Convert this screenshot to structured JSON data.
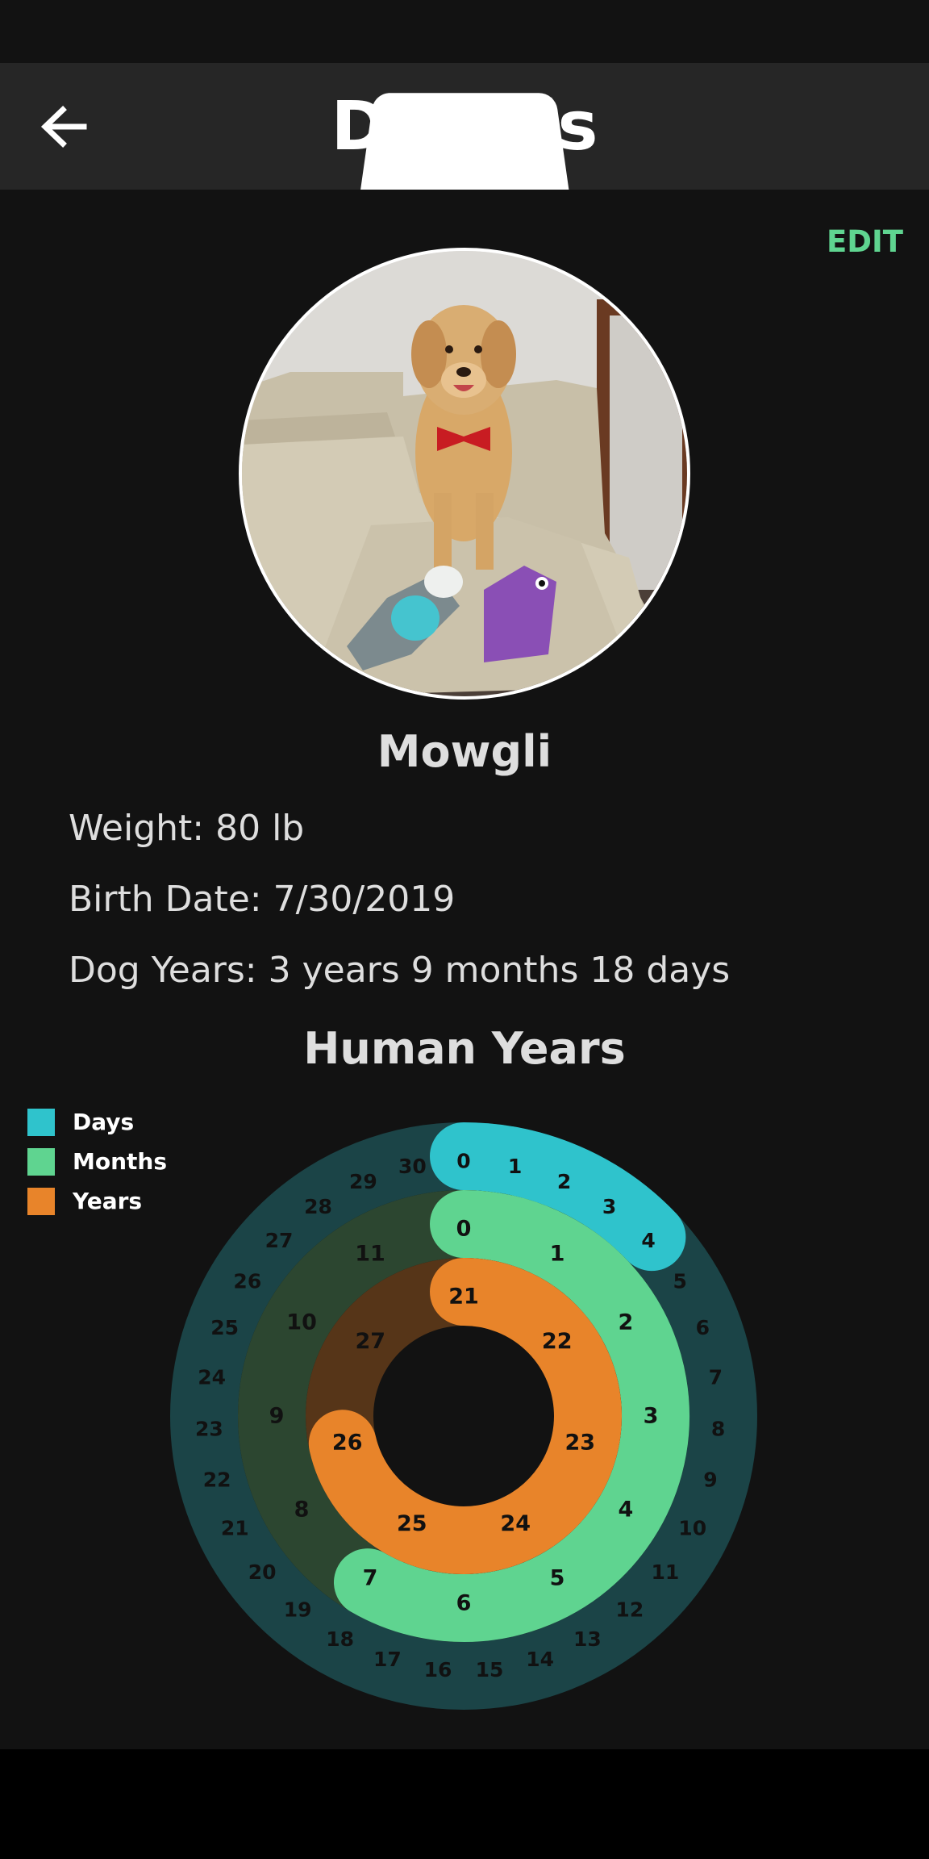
{
  "header": {
    "title": "Details",
    "back_icon": "arrow-left-icon",
    "settings_icon": "gear-icon"
  },
  "edit_label": "EDIT",
  "profile": {
    "photo_desc": "golden-retriever-photo",
    "name": "Mowgli",
    "weight": "Weight: 80 lb",
    "birth_date": "Birth Date: 7/30/2019",
    "dog_years": "Dog Years: 3 years 9 months 18 days"
  },
  "chart_title": "Human Years",
  "legend": [
    {
      "label": "Days",
      "color": "#2fc3cc"
    },
    {
      "label": "Months",
      "color": "#5fd490"
    },
    {
      "label": "Years",
      "color": "#e8842a"
    }
  ],
  "colors": {
    "accent": "#5fd490",
    "days": "#2fc3cc",
    "months": "#5fd490",
    "years": "#e8842a",
    "days_track": "#1b4447",
    "months_track": "#2c4630",
    "years_track": "#563518",
    "background": "#121212"
  },
  "chart_data": {
    "type": "radial-progress",
    "title": "Human Years",
    "series": [
      {
        "name": "Days",
        "ticks": [
          0,
          1,
          2,
          3,
          4,
          5,
          6,
          7,
          8,
          9,
          10,
          11,
          12,
          13,
          14,
          15,
          16,
          17,
          18,
          19,
          20,
          21,
          22,
          23,
          24,
          25,
          26,
          27,
          28,
          29,
          30
        ],
        "value": 4
      },
      {
        "name": "Months",
        "ticks": [
          0,
          1,
          2,
          3,
          4,
          5,
          6,
          7,
          8,
          9,
          10,
          11
        ],
        "value": 7
      },
      {
        "name": "Years",
        "ticks": [
          21,
          22,
          23,
          24,
          25,
          26,
          27
        ],
        "value": 26
      }
    ]
  }
}
